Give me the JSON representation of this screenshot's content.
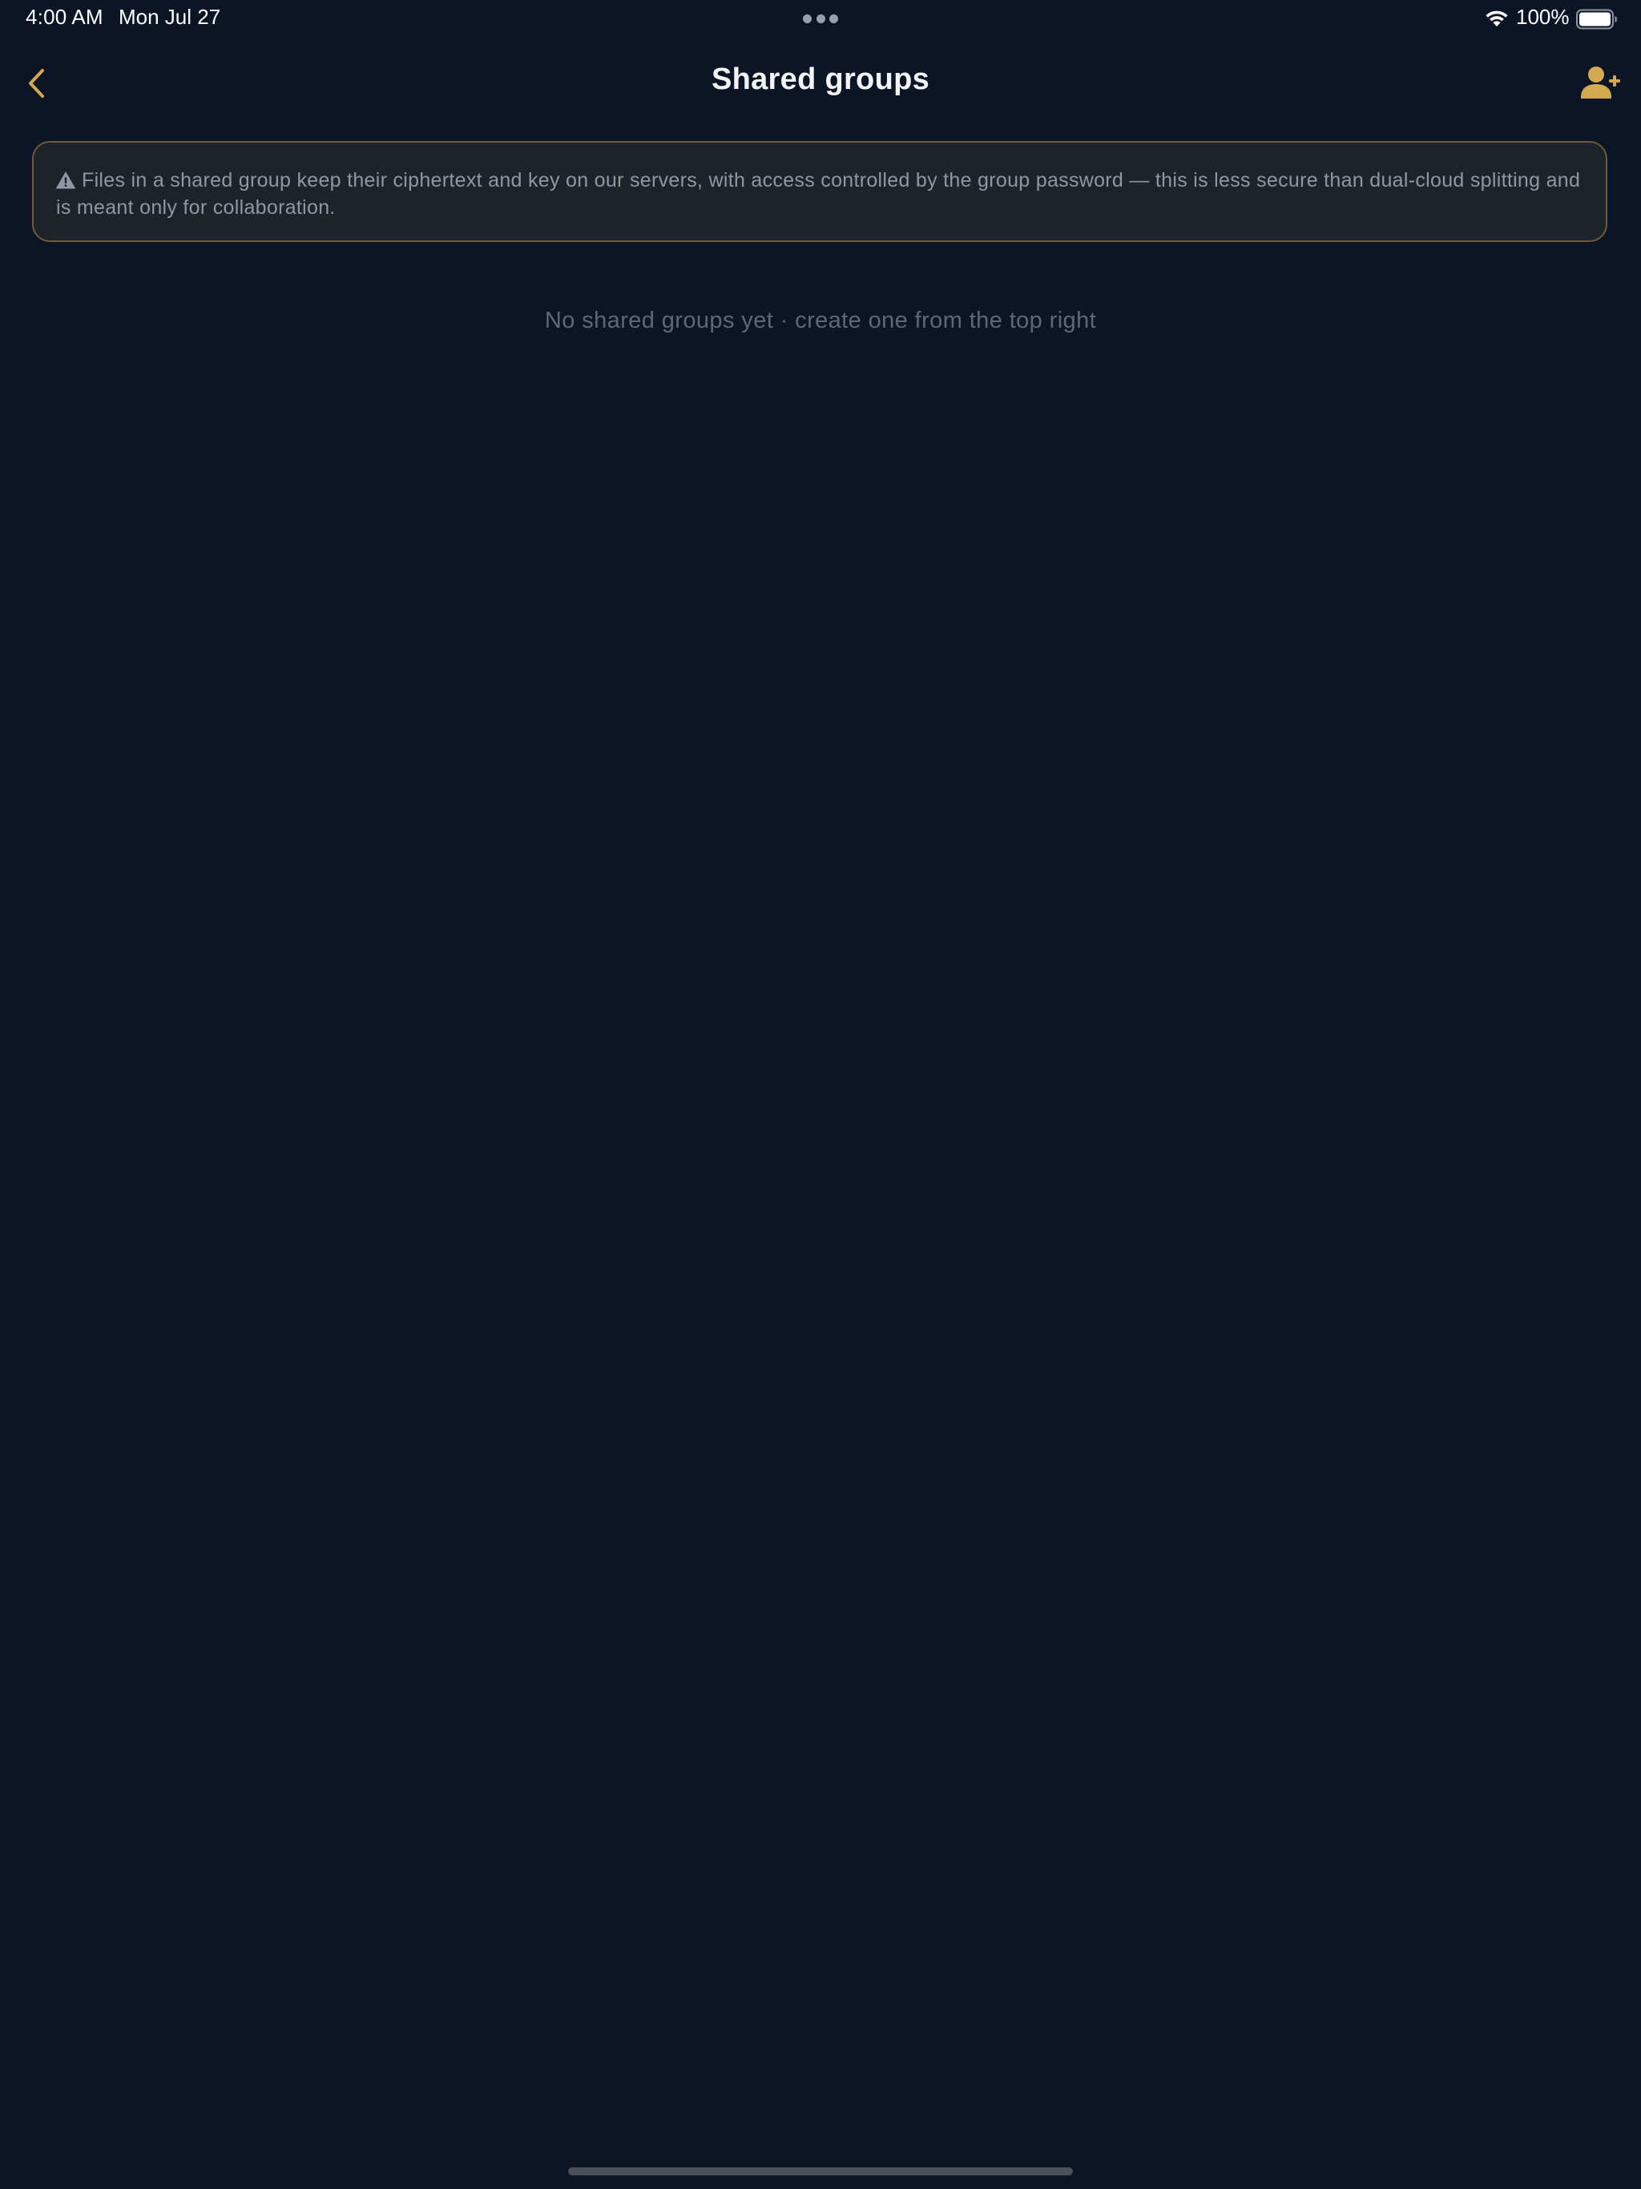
{
  "status_bar": {
    "time": "4:00 AM",
    "date": "Mon Jul 27",
    "battery_percent": "100%",
    "battery_level": 1.0,
    "wifi_icon": "wifi-icon",
    "battery_icon": "battery-icon"
  },
  "nav": {
    "title": "Shared groups",
    "back_icon": "chevron-left-icon",
    "add_icon": "add-person-icon"
  },
  "warning": {
    "icon": "warning-triangle-icon",
    "text": "Files in a shared group keep their ciphertext and key on our servers, with access controlled by the group password — this is less secure than dual-cloud splitting and is meant only for collaboration."
  },
  "empty_state": {
    "text": "No shared groups yet · create one from the top right"
  },
  "colors": {
    "background": "#0b1526",
    "accent": "#d4a94f",
    "banner_bg": "#1e2229",
    "banner_border": "#6e5a38",
    "muted_text": "#5d6778"
  }
}
